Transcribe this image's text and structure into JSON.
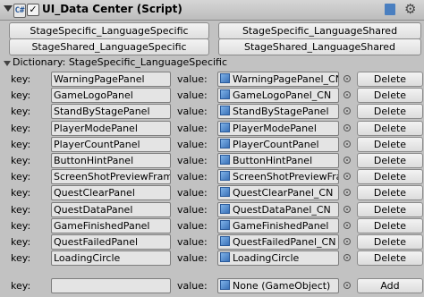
{
  "header": {
    "title": "UI_Data Center (Script)",
    "enabled_mark": "✓",
    "script_glyph": "C#",
    "gear_glyph": "⚙"
  },
  "toolbar": {
    "buttons": [
      "StageSpecific_LanguageSpecific",
      "StageSpecific_LanguageShared",
      "StageShared_LanguageSpecific",
      "StageShared_LanguageShared"
    ]
  },
  "dictionary": {
    "label": "Dictionary: StageSpecific_LanguageSpecific",
    "key_label": "key:",
    "value_label": "value:",
    "delete_label": "Delete",
    "entries": [
      {
        "key": "WarningPagePanel",
        "value": "WarningPagePanel_CN"
      },
      {
        "key": "GameLogoPanel",
        "value": "GameLogoPanel_CN"
      },
      {
        "key": "StandByStagePanel",
        "value": "StandByStagePanel"
      },
      {
        "key": "PlayerModePanel",
        "value": "PlayerModePanel"
      },
      {
        "key": "PlayerCountPanel",
        "value": "PlayerCountPanel"
      },
      {
        "key": "ButtonHintPanel",
        "value": "ButtonHintPanel"
      },
      {
        "key": "ScreenShotPreviewFrame",
        "value": "ScreenShotPreviewFrame"
      },
      {
        "key": "QuestClearPanel",
        "value": "QuestClearPanel_CN"
      },
      {
        "key": "QuestDataPanel",
        "value": "QuestDataPanel_CN"
      },
      {
        "key": "GameFinishedPanel",
        "value": "GameFinishedPanel"
      },
      {
        "key": "QuestFailedPanel",
        "value": "QuestFailedPanel_CN"
      },
      {
        "key": "LoadingCircle",
        "value": "LoadingCircle"
      }
    ],
    "new_entry": {
      "key_value": "",
      "value_value": "None (GameObject)",
      "add_label": "Add"
    }
  },
  "colors": {
    "background": "#c2c2c2",
    "object_icon": "#3b72b8"
  }
}
